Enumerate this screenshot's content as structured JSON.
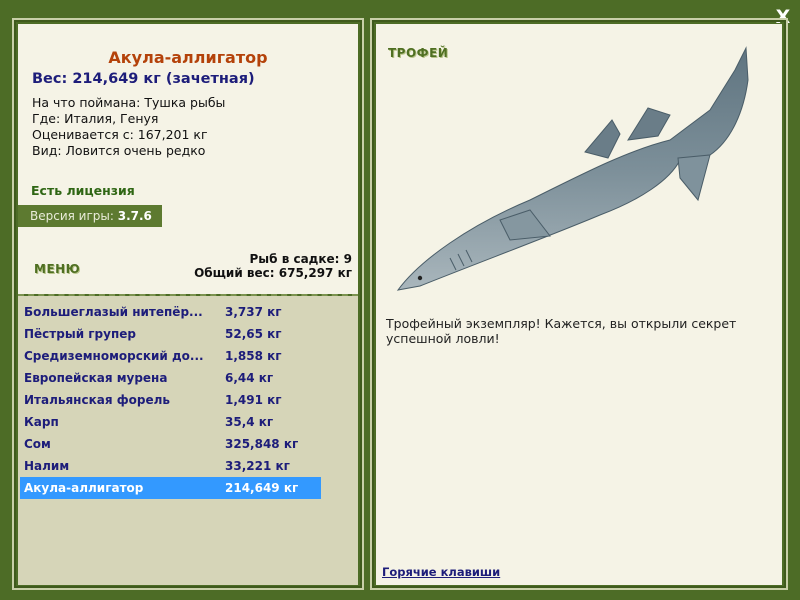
{
  "close_label": "X",
  "fish": {
    "title": "Акула-аллигатор",
    "weight_line": "Вес: 214,649 кг (зачетная)",
    "caught_with": "На что поймана: Тушка рыбы",
    "location": "Где: Италия, Генуя",
    "valued_from": "Оценивается с: 167,201 кг",
    "rarity": "Вид: Ловится очень редко"
  },
  "license_text": "Есть лицензия",
  "version": {
    "label": "Версия игры:",
    "value": "3.7.6"
  },
  "menu_label": "МЕНЮ",
  "stats": {
    "in_keepnet": "Рыб в садке: 9",
    "total_weight": "Общий вес: 675,297 кг"
  },
  "catch_list": [
    {
      "name": "Большеглазый нитепёр...",
      "weight": "3,737 кг"
    },
    {
      "name": "Пёстрый групер",
      "weight": "52,65 кг"
    },
    {
      "name": "Средиземноморский до...",
      "weight": "1,858 кг"
    },
    {
      "name": "Европейская мурена",
      "weight": "6,44 кг"
    },
    {
      "name": "Итальянская форель",
      "weight": "1,491 кг"
    },
    {
      "name": "Карп",
      "weight": "35,4 кг"
    },
    {
      "name": "Сом",
      "weight": "325,848 кг"
    },
    {
      "name": "Налим",
      "weight": "33,221 кг"
    },
    {
      "name": "Акула-аллигатор",
      "weight": "214,649 кг"
    }
  ],
  "selected_index": 8,
  "trophy": {
    "label": "ТРОФЕЙ",
    "text": "Трофейный экземпляр! Кажется, вы открыли секрет успешной ловли!"
  },
  "hotkeys_link": "Горячие клавиши",
  "colors": {
    "background": "#4d6c26",
    "panel": "#f5f3e6",
    "list_bg": "#d6d5b8",
    "selection": "#3399ff",
    "title": "#b4420a",
    "link": "#1d1d7a"
  }
}
